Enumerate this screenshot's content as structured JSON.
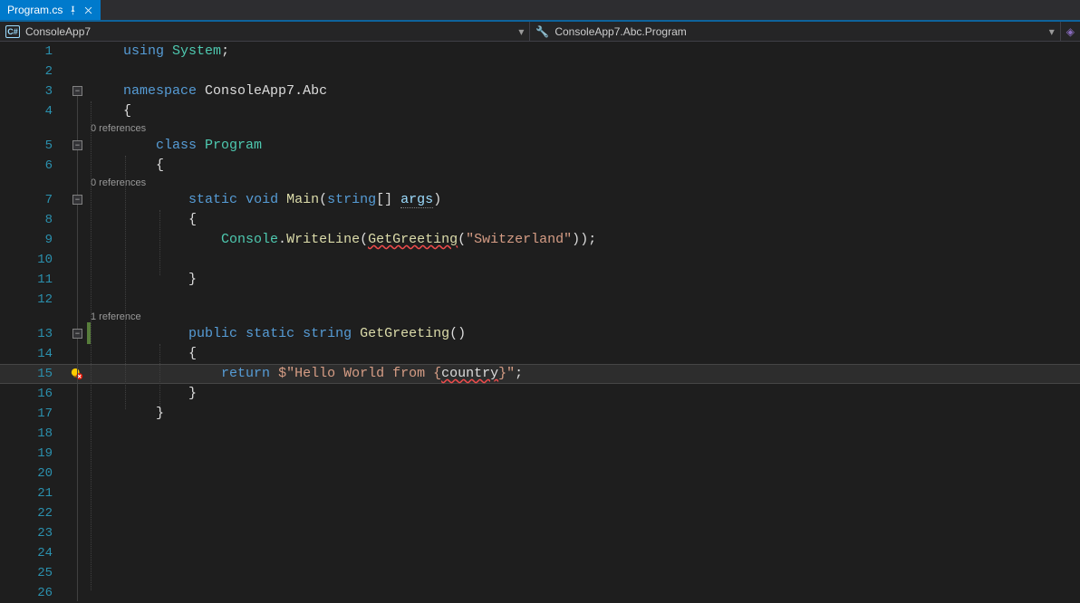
{
  "tab": {
    "filename": "Program.cs"
  },
  "nav": {
    "left": "ConsoleApp7",
    "right": "ConsoleApp7.Abc.Program"
  },
  "codelens": {
    "class": "0 references",
    "main": "0 references",
    "getgreeting": "1 reference"
  },
  "code": {
    "l1_using": "using",
    "l1_system": "System",
    "l3_namespace": "namespace",
    "l3_ns": "ConsoleApp7.Abc",
    "l5_class": "class",
    "l5_name": "Program",
    "l7_static": "static",
    "l7_void": "void",
    "l7_main": "Main",
    "l7_string": "string",
    "l7_args": "args",
    "l9_console": "Console",
    "l9_writeline": "WriteLine",
    "l9_getgreeting": "GetGreeting",
    "l9_arg": "\"Switzerland\"",
    "l13_public": "public",
    "l13_static": "static",
    "l13_string": "string",
    "l13_name": "GetGreeting",
    "l15_return": "return",
    "l15_prefix": "$\"Hello World from {",
    "l15_country": "country",
    "l15_suffix": "}\"",
    "brace_open": "{",
    "brace_close": "}",
    "semi": ";",
    "paren_open": "(",
    "paren_close": ")",
    "brackets": "[]",
    "dot": "."
  },
  "lines": [
    "1",
    "2",
    "3",
    "4",
    "5",
    "6",
    "7",
    "8",
    "9",
    "10",
    "11",
    "12",
    "13",
    "14",
    "15",
    "16",
    "17",
    "18",
    "19",
    "20",
    "21",
    "22",
    "23",
    "24",
    "25",
    "26"
  ]
}
